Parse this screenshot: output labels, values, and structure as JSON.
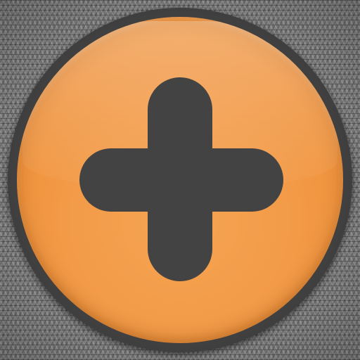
{
  "icon": {
    "name": "plus-icon",
    "accent_color": "#f29a47",
    "symbol_color": "#434343",
    "background_color": "#858585"
  }
}
